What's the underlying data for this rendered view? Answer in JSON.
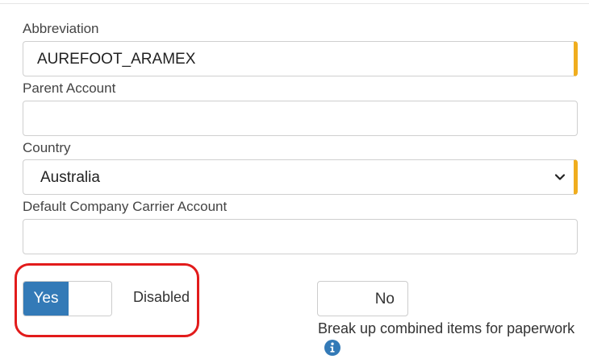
{
  "form": {
    "abbreviation": {
      "label": "Abbreviation",
      "value": "AUREFOOT_ARAMEX"
    },
    "parent_account": {
      "label": "Parent Account",
      "value": ""
    },
    "country": {
      "label": "Country",
      "value": "Australia"
    },
    "default_carrier": {
      "label": "Default Company Carrier Account",
      "value": ""
    },
    "status_toggle": {
      "on_label": "Yes",
      "state_label": "Disabled"
    },
    "break_up_toggle": {
      "off_label": "No",
      "label": "Break up combined items for paperwork"
    }
  },
  "colors": {
    "required_marker": "#f0ad1e",
    "toggle_on": "#337ab7",
    "highlight": "#e21b1b"
  },
  "icons": {
    "info": "info-icon",
    "select": "chevron-down-icon"
  }
}
